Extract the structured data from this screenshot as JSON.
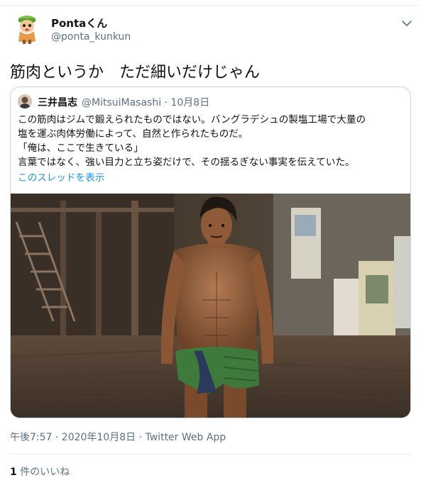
{
  "author": {
    "name": "Pontaくん",
    "handle": "@ponta_kunkun"
  },
  "tweet": {
    "text": "筋肉というか　ただ細いだけじゃん"
  },
  "quoted": {
    "name": "三井昌志",
    "handle": "@MitsuiMasashi",
    "date": "10月8日",
    "separator": " · ",
    "lines": [
      "この筋肉はジムで鍛えられたものではない。バングラデシュの製塩工場で大量の",
      "塩を運ぶ肉体労働によって、自然と作られたものだ。",
      "「俺は、ここで生きている」",
      "言葉ではなく、強い目力と立ち姿だけで、その揺るぎない事実を伝えていた。"
    ],
    "thread_link": "このスレッドを表示"
  },
  "meta": {
    "time": "午後7:57 · 2020年10月8日 · ",
    "app": "Twitter Web App"
  },
  "likes": {
    "count": "1",
    "label": " 件のいいね"
  },
  "colors": {
    "text": "#0f1419",
    "secondary": "#5b7083",
    "link": "#1b95e0",
    "border": "#ccd6dd"
  },
  "icons": {
    "caret": "chevron-down-icon"
  }
}
